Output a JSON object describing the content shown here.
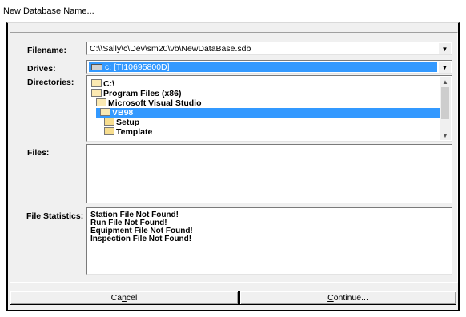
{
  "window": {
    "title": "New Database Name..."
  },
  "filename": {
    "label": "Filename:",
    "value": "C:\\\\Sally\\c\\Dev\\sm20\\vb\\NewDataBase.sdb"
  },
  "drives": {
    "label": "Drives:",
    "value": "c: [TI10695800D]"
  },
  "directories": {
    "label": "Directories:",
    "items": [
      {
        "label": "C:\\",
        "icon": "open-folder-icon"
      },
      {
        "label": "Program Files (x86)",
        "icon": "open-folder-icon"
      },
      {
        "label": "Microsoft Visual Studio",
        "icon": "open-folder-icon"
      },
      {
        "label": "VB98",
        "icon": "open-folder-icon",
        "selected": true
      },
      {
        "label": "Setup",
        "icon": "folder-icon"
      },
      {
        "label": "Template",
        "icon": "folder-icon"
      }
    ]
  },
  "files": {
    "label": "Files:",
    "items": []
  },
  "file_statistics": {
    "label": "File Statistics:",
    "lines": [
      "Station File Not Found!",
      "Run File Not Found!",
      "Equipment File Not Found!",
      "Inspection File Not Found!"
    ]
  },
  "buttons": {
    "cancel": {
      "pre": "Ca",
      "u": "n",
      "post": "cel"
    },
    "continue": {
      "pre": "",
      "u": "C",
      "post": "ontinue..."
    }
  },
  "colors": {
    "selection": "#3399ff",
    "face": "#f0f0f0"
  }
}
